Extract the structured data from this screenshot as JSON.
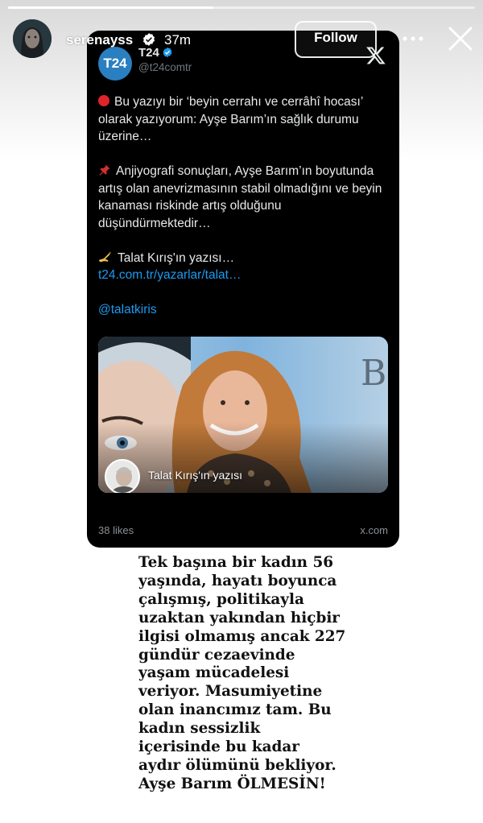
{
  "story": {
    "progress": 0.44,
    "username": "serenayss",
    "time": "37m",
    "follow_label": "Follow",
    "icons": {
      "verified": "verified-badge-icon",
      "more": "more-horizontal-icon",
      "close": "close-icon"
    }
  },
  "tweet": {
    "account_name": "T24",
    "logo_text": "T24",
    "handle": "@t24comtr",
    "lines": {
      "p1_l1": "Bu yazıyı bir ‘beyin cerrahı ve cerrâhî hocası’",
      "p1_l2": "olarak yazıyorum: Ayşe Barım’ın sağlık durumu",
      "p1_l3": "üzerine…",
      "p2_l1": "Anjiyografi sonuçları, Ayşe Barım’ın boyutunda",
      "p2_l2": "artış olan anevrizmasının stabil olmadığını ve beyin",
      "p2_l3": "kanaması riskinde artış olduğunu",
      "p2_l4": "düşündürmektedir…",
      "p3_l1": "Talat Kırış'ın yazısı…",
      "link": "t24.com.tr/yazarlar/talat…",
      "mention": "@talatkiris"
    },
    "media_caption": "Talat Kırış'ın yazısı",
    "media_letter": "B",
    "likes": "38 likes",
    "source": "x.com",
    "colors": {
      "link": "#1d9bf0",
      "logo": "#2a7fc1",
      "background": "#000000"
    }
  },
  "caption": {
    "lines": [
      "Tek başına bir kadın 56",
      "yaşında,  hayatı boyunca",
      "çalışmış, politikayla",
      "uzaktan yakından hiçbir",
      "ilgisi olmamış ancak 227",
      "gündür cezaevinde",
      "yaşam mücadelesi",
      "veriyor. Masumiyetine",
      "olan inancımız tam. Bu",
      "kadın sessizlik",
      "içerisinde bu kadar",
      "aydır ölümünü bekliyor.",
      "Ayşe Barım ÖLMESİN!"
    ]
  }
}
